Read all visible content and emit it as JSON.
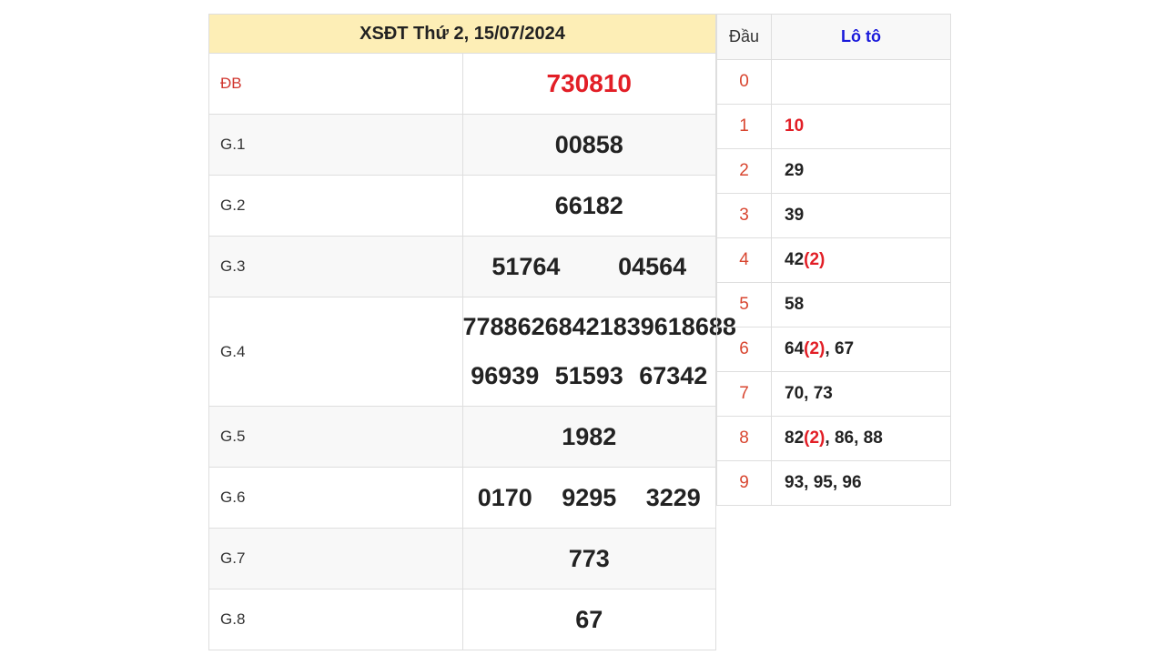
{
  "results": {
    "title": "XSĐT Thứ 2, 15/07/2024",
    "prizes": [
      {
        "label": "ĐB",
        "numbers": [
          "730810"
        ]
      },
      {
        "label": "G.1",
        "numbers": [
          "00858"
        ]
      },
      {
        "label": "G.2",
        "numbers": [
          "66182"
        ]
      },
      {
        "label": "G.3",
        "numbers": [
          "51764",
          "04564"
        ]
      },
      {
        "label": "G.4",
        "numbers": [
          "77886",
          "26842",
          "18396",
          "18688",
          "96939",
          "51593",
          "67342"
        ]
      },
      {
        "label": "G.5",
        "numbers": [
          "1982"
        ]
      },
      {
        "label": "G.6",
        "numbers": [
          "0170",
          "9295",
          "3229"
        ]
      },
      {
        "label": "G.7",
        "numbers": [
          "773"
        ]
      },
      {
        "label": "G.8",
        "numbers": [
          "67"
        ]
      }
    ]
  },
  "loto": {
    "header_dau": "Đầu",
    "header_loto": "Lô tô",
    "rows": [
      {
        "dau": "0",
        "items": []
      },
      {
        "dau": "1",
        "items": [
          {
            "n": "10"
          }
        ]
      },
      {
        "dau": "2",
        "items": [
          {
            "n": "29"
          }
        ]
      },
      {
        "dau": "3",
        "items": [
          {
            "n": "39"
          }
        ]
      },
      {
        "dau": "4",
        "items": [
          {
            "n": "42",
            "count": "(2)"
          }
        ]
      },
      {
        "dau": "5",
        "items": [
          {
            "n": "58"
          }
        ]
      },
      {
        "dau": "6",
        "items": [
          {
            "n": "64",
            "count": "(2)"
          },
          {
            "n": "67"
          }
        ]
      },
      {
        "dau": "7",
        "items": [
          {
            "n": "70"
          },
          {
            "n": "73"
          }
        ]
      },
      {
        "dau": "8",
        "items": [
          {
            "n": "82",
            "count": "(2)"
          },
          {
            "n": "86"
          },
          {
            "n": "88"
          }
        ]
      },
      {
        "dau": "9",
        "items": [
          {
            "n": "93"
          },
          {
            "n": "95"
          },
          {
            "n": "96"
          }
        ]
      }
    ]
  },
  "colors": {
    "special": "#e21e26",
    "header_bg": "#fdeeb6",
    "loto_header": "#1a1adb",
    "dau": "#d8452f"
  }
}
